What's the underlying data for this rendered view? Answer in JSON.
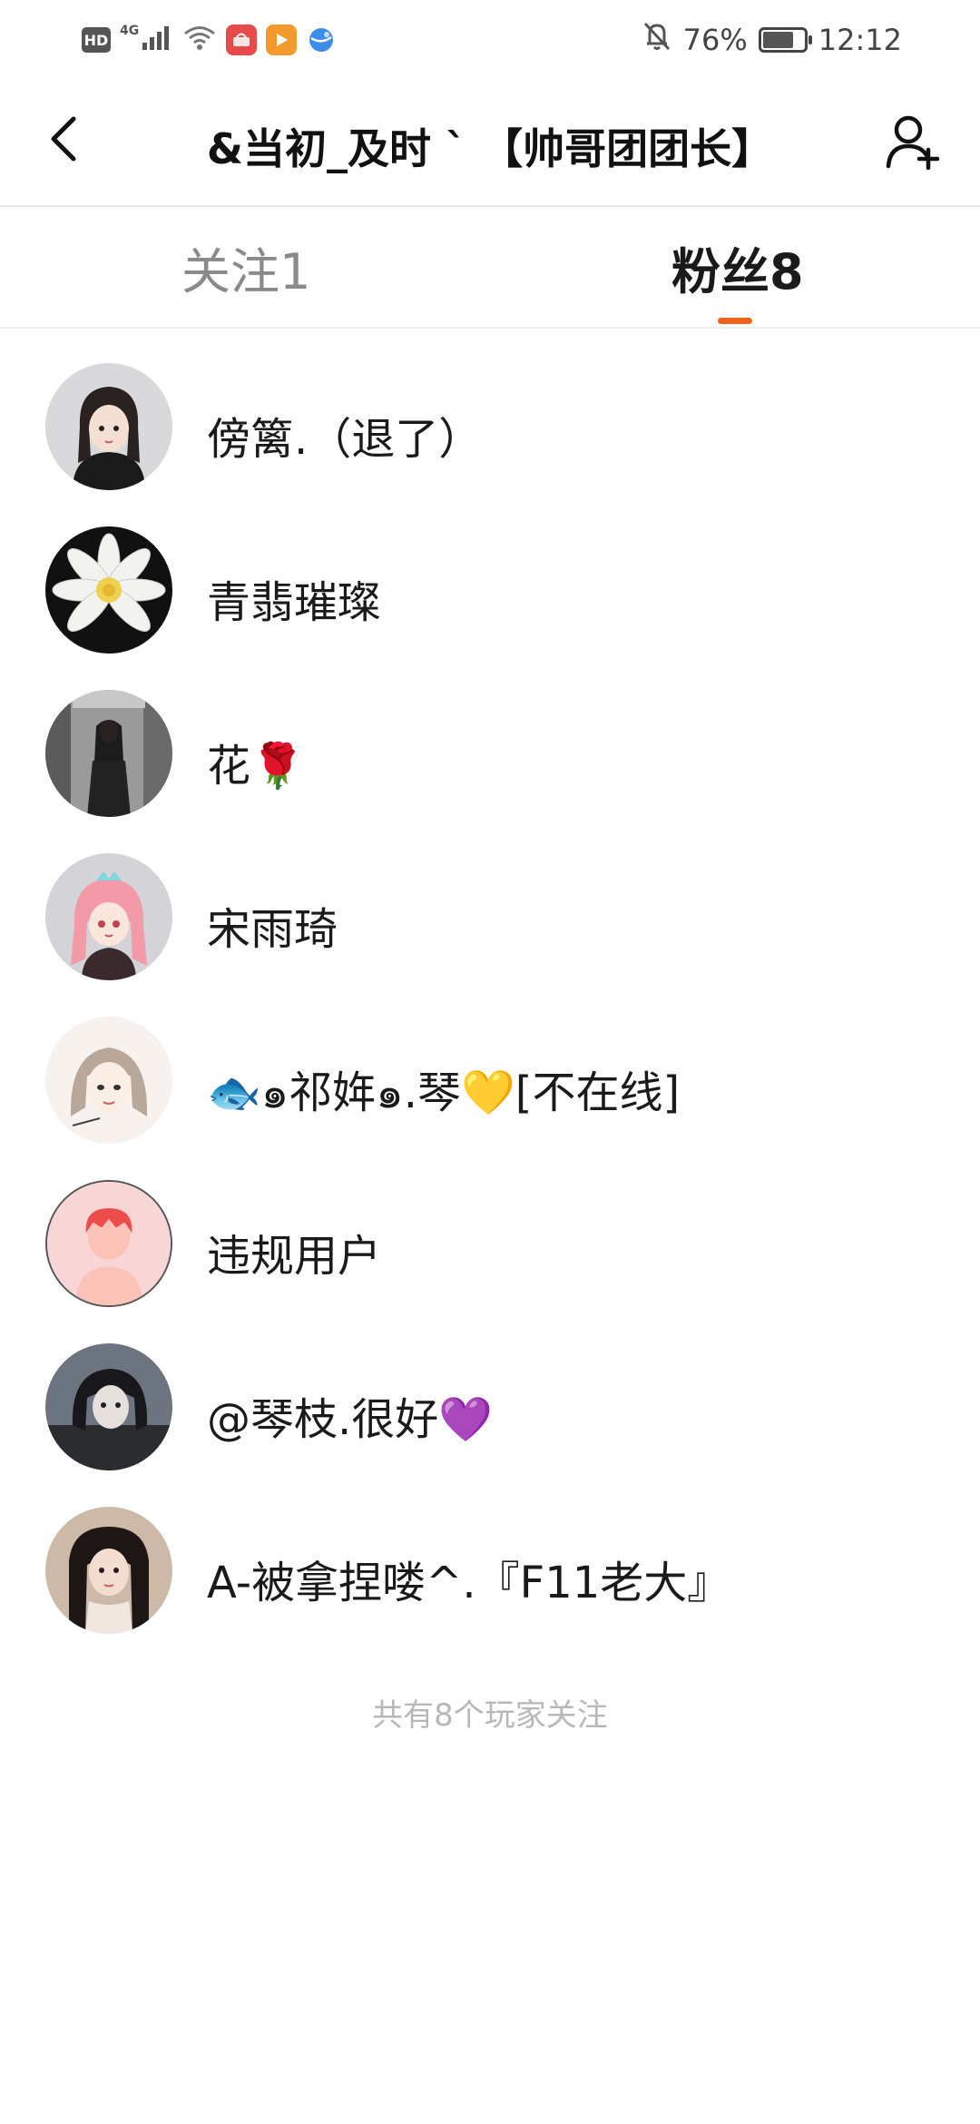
{
  "status_bar": {
    "hd_label": "HD",
    "network_label": "4G",
    "battery_text": "76%",
    "battery_level": 0.76,
    "time": "12:12",
    "icons": [
      "hd-icon",
      "signal-icon",
      "wifi-icon",
      "huawei-app-icon",
      "video-app-icon",
      "browser-app-icon",
      "mute-bell-icon",
      "battery-icon"
    ]
  },
  "header": {
    "title": "&当初_及时 ` 【帅哥团团长】",
    "back_icon": "chevron-left-icon",
    "add_friend_icon": "add-user-icon"
  },
  "tabs": [
    {
      "label": "关注1",
      "active": false
    },
    {
      "label": "粉丝8",
      "active": true
    }
  ],
  "accent_color": "#f0621e",
  "followers": [
    {
      "name": "傍篱.（退了）",
      "avatar": "anime-girl-dark-hair-avatar"
    },
    {
      "name": "青翡璀璨",
      "avatar": "white-lotus-avatar"
    },
    {
      "name": "花🌹",
      "avatar": "girl-in-closet-avatar"
    },
    {
      "name": "宋雨琦",
      "avatar": "anime-pink-hair-avatar"
    },
    {
      "name": "🐟๑祁姩๑.琴💛[不在线]",
      "avatar": "drawn-girl-avatar"
    },
    {
      "name": "违规用户",
      "avatar": "default-red-user-avatar"
    },
    {
      "name": "@琴枝.很好💜",
      "avatar": "dark-photo-girl-avatar"
    },
    {
      "name": "A-被拿捏喽^.『F11老大』",
      "avatar": "portrait-girl-avatar"
    }
  ],
  "footer": {
    "note": "共有8个玩家关注"
  }
}
